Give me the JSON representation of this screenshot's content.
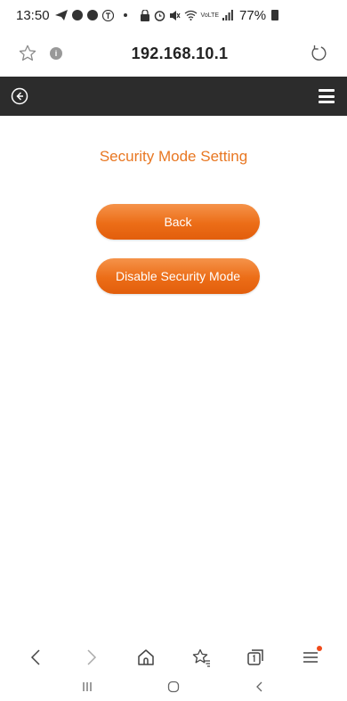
{
  "status_bar": {
    "time": "13:50",
    "battery_percent": "77%",
    "icons": [
      "telegram-icon",
      "chat-icon",
      "messenger-icon",
      "t-app-icon",
      "dot-separator",
      "lock-icon",
      "alarm-icon",
      "mute-icon",
      "wifi-icon",
      "volte-icon",
      "signal-icon",
      "battery-icon"
    ],
    "volte_text": "VoLTE"
  },
  "browser": {
    "url": "192.168.10.1",
    "info_glyph": "i"
  },
  "page": {
    "title": "Security Mode Setting",
    "back_button": "Back",
    "disable_button": "Disable Security Mode"
  },
  "colors": {
    "accent": "#e87722",
    "header_bg": "#2c2c2c",
    "button_top": "#f5934a",
    "button_bottom": "#e25e0c"
  }
}
